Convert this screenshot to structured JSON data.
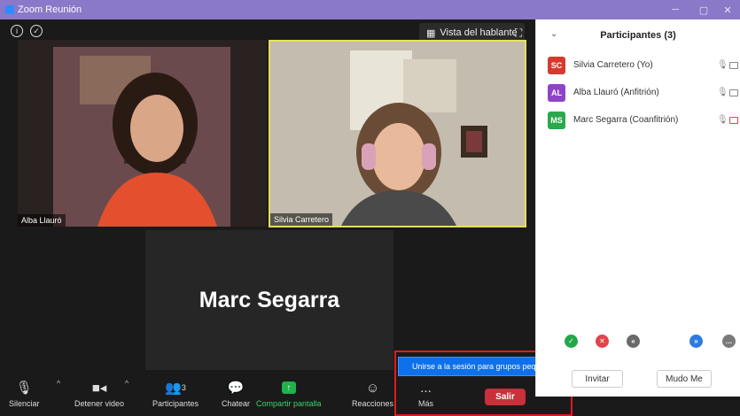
{
  "window": {
    "title": "Zoom Reunión"
  },
  "header": {
    "speaker_view_label": "Vista del hablante"
  },
  "videos": {
    "tile1_name": "Alba Llauró",
    "tile2_name": "Silvia Carretero",
    "tile3_name": "Marc Segarra"
  },
  "toolbar": {
    "mute_label": "Silenciar",
    "video_label": "Detener video",
    "participants_label": "Participantes",
    "participants_count": "3",
    "chat_label": "Chatear",
    "share_label": "Compartir pantalla",
    "reactions_label": "Reacciones",
    "more_label": "Más",
    "more_dots": "...",
    "leave_label": "Salir"
  },
  "popup": {
    "breakout_label": "Unirse a la sesión para grupos pequeños"
  },
  "panel": {
    "title": "Participantes (3)",
    "participants": [
      {
        "initials": "SC",
        "name": "Silvia Carretero (Yo)",
        "color": "#d63a2f",
        "camera_off": false
      },
      {
        "initials": "AL",
        "name": "Alba Llauró (Anfitrión)",
        "color": "#8e44c8",
        "camera_off": false
      },
      {
        "initials": "MS",
        "name": "Marc Segarra (Coanfitrión)",
        "color": "#2aa84a",
        "camera_off": true
      }
    ],
    "invite_label": "Invitar",
    "mute_me_label": "Mudo Me"
  },
  "colors": {
    "titlebar": "#8a78c8",
    "share_green": "#22b14c",
    "leave_red": "#c8303a",
    "popup_blue": "#0e71eb",
    "highlight_red": "#e3191c",
    "active_speaker": "#e6df5a"
  }
}
